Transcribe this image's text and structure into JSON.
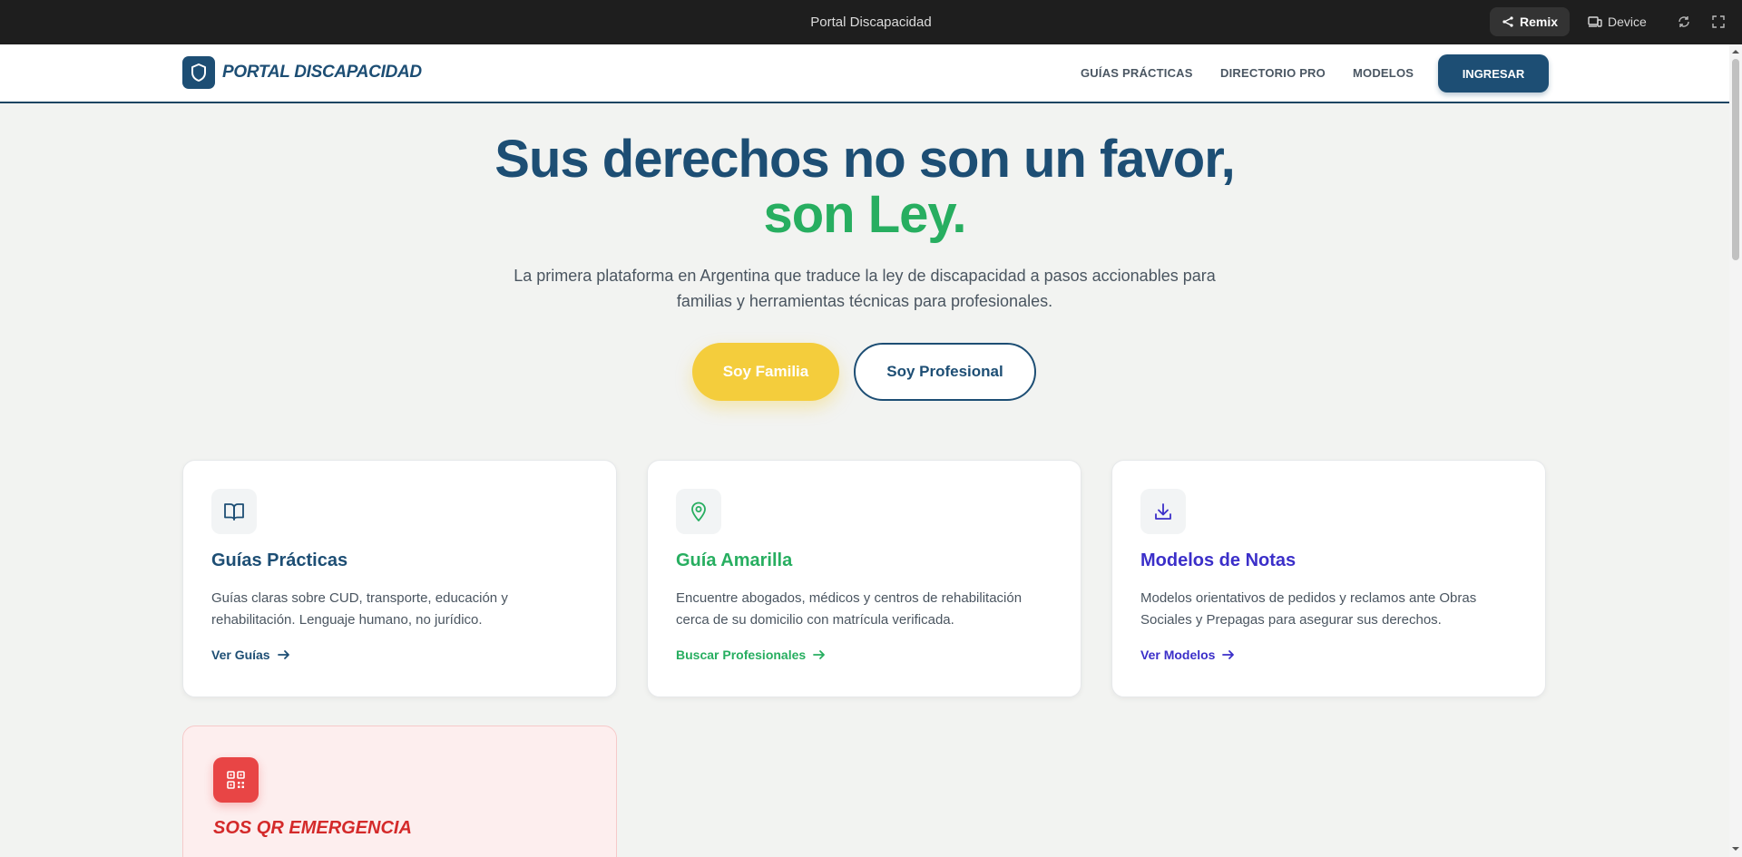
{
  "browser": {
    "title": "Portal Discapacidad",
    "remix_label": "Remix",
    "device_label": "Device"
  },
  "nav": {
    "brand": "PORTAL DISCAPACIDAD",
    "links": [
      "GUÍAS PRÁCTICAS",
      "DIRECTORIO PRO",
      "MODELOS"
    ],
    "login_label": "INGRESAR"
  },
  "hero": {
    "title_line1": "Sus derechos no son un favor,",
    "title_line2": "son Ley.",
    "subtitle": "La primera plataforma en Argentina que traduce la ley de discapacidad a pasos accionables para familias y herramientas técnicas para profesionales.",
    "btn_family": "Soy Familia",
    "btn_professional": "Soy Profesional"
  },
  "cards": [
    {
      "title": "Guías Prácticas",
      "description": "Guías claras sobre CUD, transporte, educación y rehabilitación. Lenguaje humano, no jurídico.",
      "link": "Ver Guías",
      "icon": "book-open-icon",
      "color": "#1d4e74"
    },
    {
      "title": "Guía Amarilla",
      "description": "Encuentre abogados, médicos y centros de rehabilitación cerca de su domicilio con matrícula verificada.",
      "link": "Buscar Profesionales",
      "icon": "map-pin-icon",
      "color": "#27ae60"
    },
    {
      "title": "Modelos de Notas",
      "description": "Modelos orientativos de pedidos y reclamos ante Obras Sociales y Prepagas para asegurar sus derechos.",
      "link": "Ver Modelos",
      "icon": "download-icon",
      "color": "#3b2fc9"
    }
  ],
  "sos": {
    "title": "SOS QR EMERGENCIA",
    "icon": "qr-code-icon",
    "color": "#d42a2a"
  }
}
